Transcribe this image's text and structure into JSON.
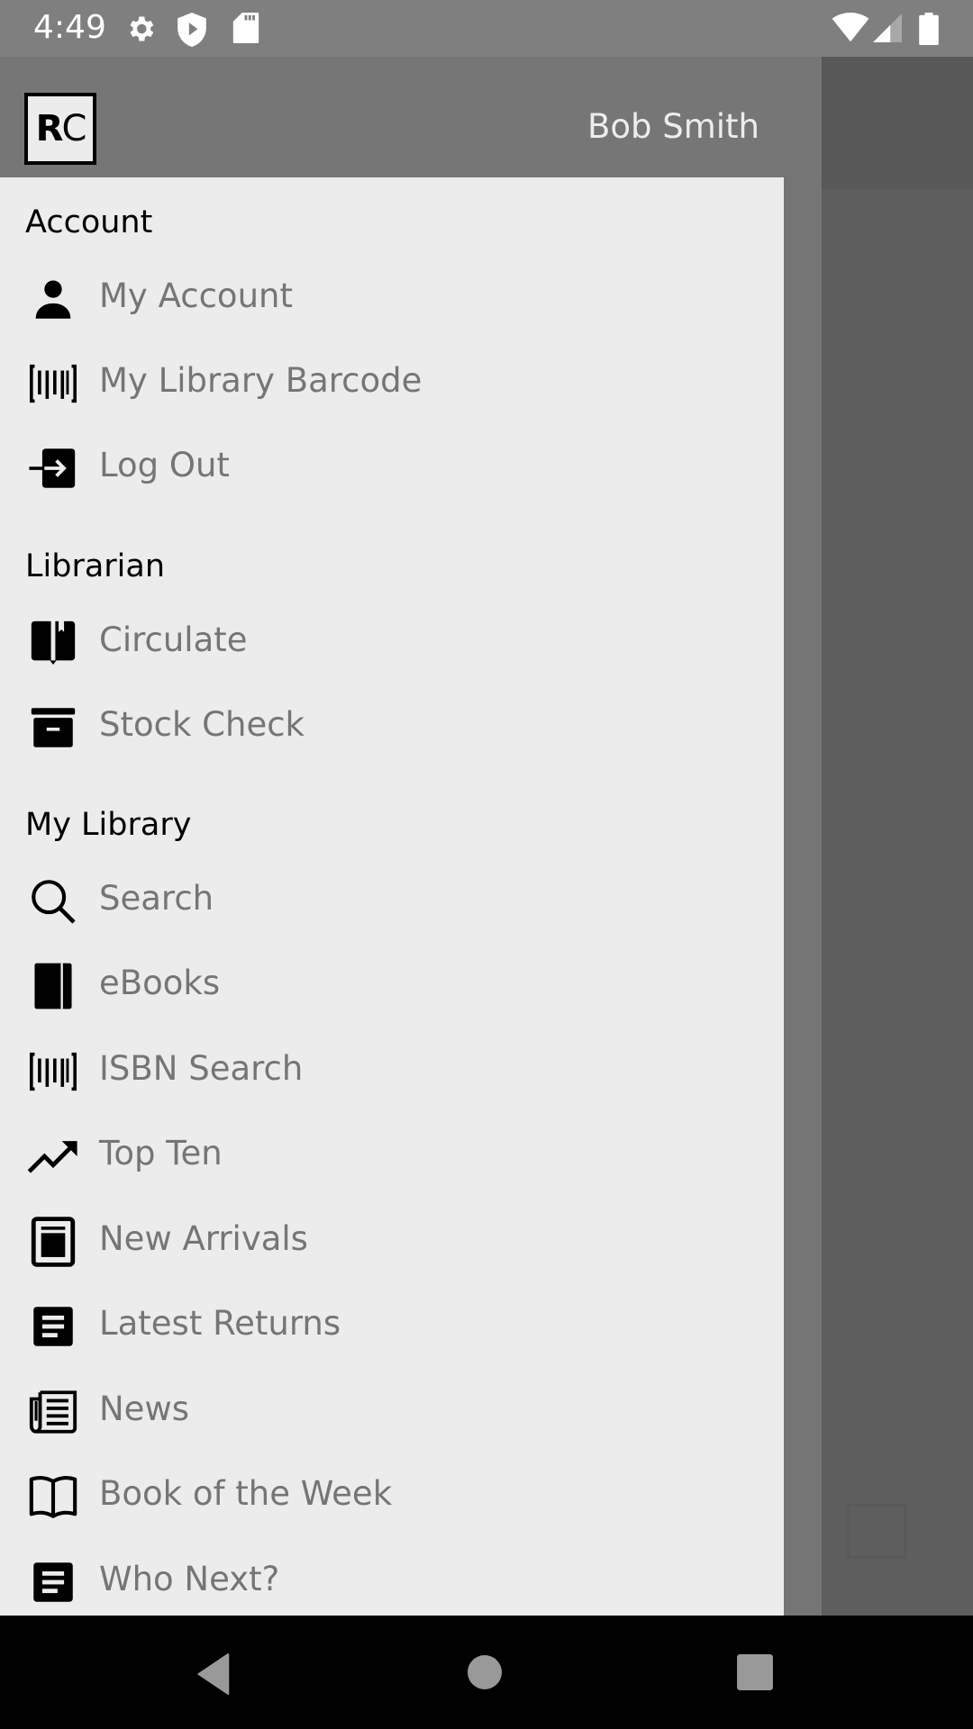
{
  "status_bar": {
    "time": "4:49",
    "icons": [
      "gear-icon",
      "shield-play-icon",
      "sd-card-icon",
      "wifi-icon",
      "signal-icon",
      "battery-icon"
    ]
  },
  "drawer": {
    "header": {
      "logo_text_bold": "R",
      "logo_text_light": "C",
      "user_name": "Bob Smith"
    },
    "sections": [
      {
        "title": "Account",
        "items": [
          {
            "label": "My Account",
            "icon": "person-icon"
          },
          {
            "label": "My Library Barcode",
            "icon": "barcode-icon"
          },
          {
            "label": "Log Out",
            "icon": "logout-icon"
          }
        ]
      },
      {
        "title": "Librarian",
        "items": [
          {
            "label": "Circulate",
            "icon": "book-bookmark-icon"
          },
          {
            "label": "Stock Check",
            "icon": "archive-box-icon"
          }
        ]
      },
      {
        "title": "My Library",
        "items": [
          {
            "label": "Search",
            "icon": "search-icon"
          },
          {
            "label": "eBooks",
            "icon": "ebook-icon"
          },
          {
            "label": "ISBN Search",
            "icon": "barcode-icon"
          },
          {
            "label": "Top Ten",
            "icon": "trending-up-icon"
          },
          {
            "label": "New Arrivals",
            "icon": "new-arrivals-icon"
          },
          {
            "label": "Latest Returns",
            "icon": "article-icon"
          },
          {
            "label": "News",
            "icon": "newspaper-icon"
          },
          {
            "label": "Book of the Week",
            "icon": "open-book-icon"
          },
          {
            "label": "Who Next?",
            "icon": "article-icon"
          }
        ]
      }
    ]
  },
  "nav_bar": {
    "buttons": [
      "back",
      "home",
      "recents"
    ]
  },
  "colors": {
    "status_bar": "#7f7f7f",
    "drawer_header": "#767676",
    "drawer_panel": "#ececec",
    "item_text": "#757575",
    "section_text": "#000000",
    "scrim": "#5e5e5e"
  }
}
